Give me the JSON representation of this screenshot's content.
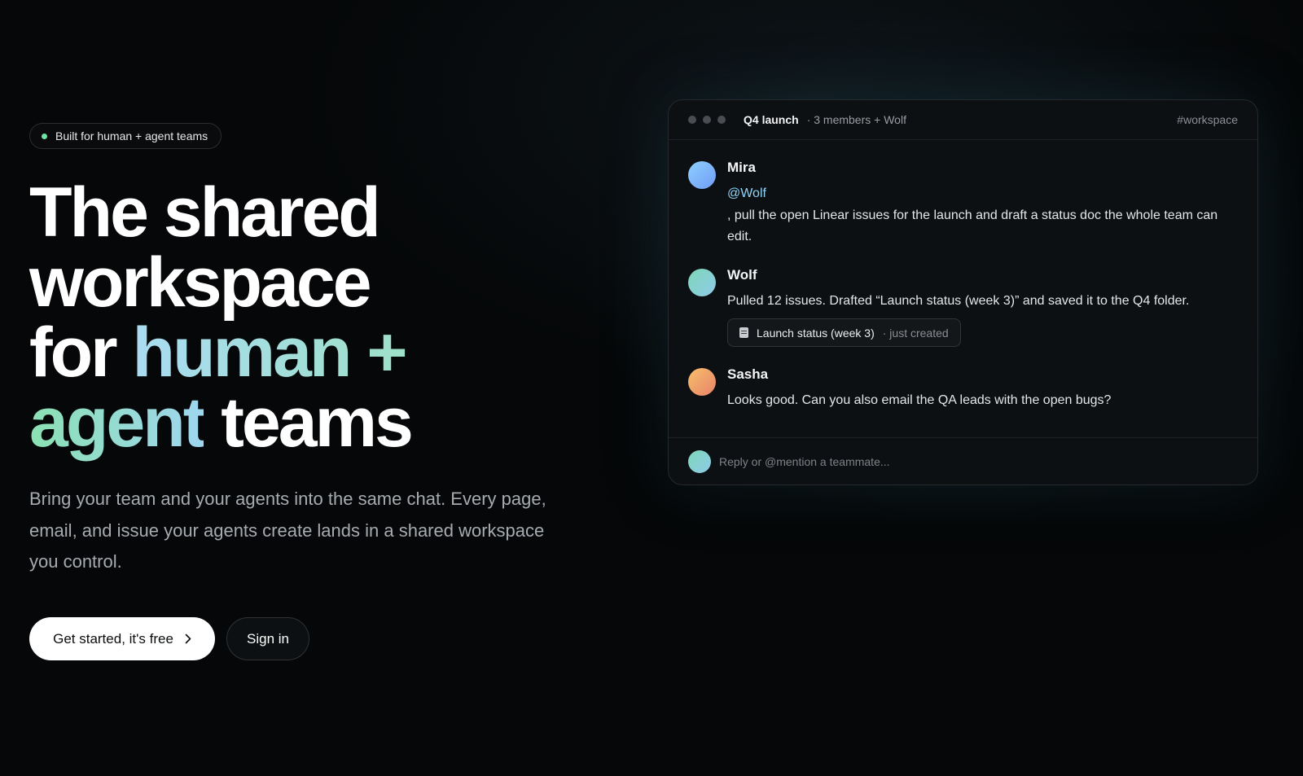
{
  "hero": {
    "badge": "Built for human + agent teams",
    "headline": {
      "line1": "The shared",
      "line2": "workspace",
      "line3_plain": "for ",
      "line3_accent": "human +",
      "line4_accent": "agent",
      "line4_plain": " teams"
    },
    "subtext": "Bring your team and your agents into the same chat. Every page, email, and issue your agents create lands in a shared workspace you control.",
    "cta_primary": "Get started, it's free",
    "cta_secondary": "Sign in"
  },
  "chat": {
    "title": "Q4 launch",
    "meta": "· 3 members + Wolf",
    "channel_tag": "#workspace",
    "messages": [
      {
        "author": "Mira",
        "mention": "@Wolf",
        "text": ", pull the open Linear issues for the launch and draft a status doc the whole team can edit."
      },
      {
        "author": "Wolf",
        "text": "Pulled 12 issues. Drafted “Launch status (week 3)” and saved it to the Q4 folder.",
        "attachment": {
          "name": "Launch status (week 3)",
          "meta": "· just created"
        }
      },
      {
        "author": "Sasha",
        "text": "Looks good. Can you also email the QA leads with the open bugs?"
      }
    ],
    "composer_placeholder": "Reply or @mention a teammate..."
  },
  "icons": {
    "badge_dot": "status-dot",
    "cta_arrow": "chevron-right-icon",
    "window_controls": "window-dots",
    "attachment": "document-icon"
  },
  "colors": {
    "accent_blue": "#a9dcf2",
    "accent_green": "#8be0b3",
    "mention": "#8fd3f5",
    "badge_dot": "#6ee7a6"
  }
}
